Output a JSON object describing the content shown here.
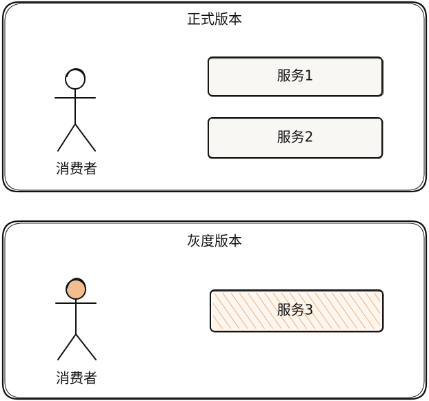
{
  "groups": {
    "official": {
      "title": "正式版本",
      "consumer_label": "消费者",
      "services": [
        "服务1",
        "服务2"
      ]
    },
    "gray": {
      "title": "灰度版本",
      "consumer_label": "消费者",
      "services": [
        "服务3"
      ]
    }
  },
  "colors": {
    "stroke": "#111111",
    "service_fill": "#f8f7f3",
    "gray_hatch": "#f2b27a"
  }
}
